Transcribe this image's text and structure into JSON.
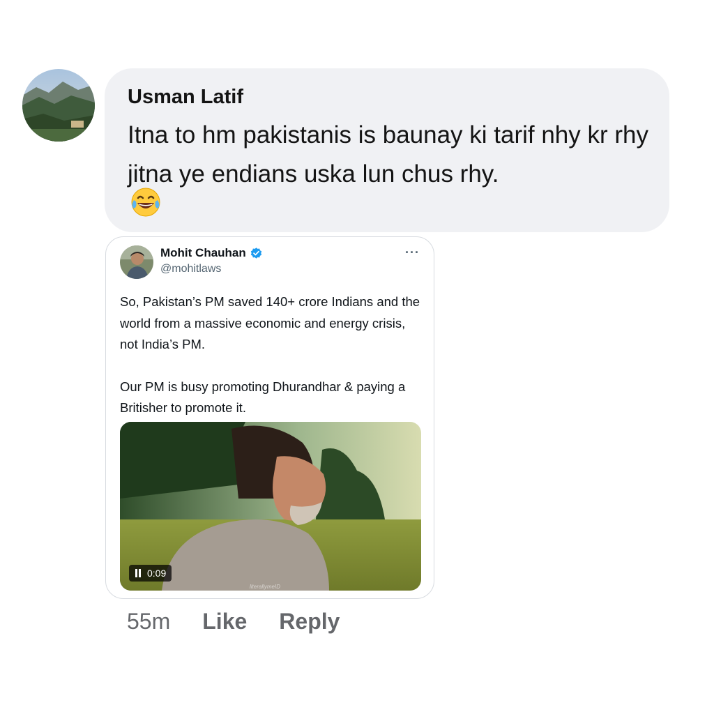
{
  "comment": {
    "author": "Usman Latif",
    "text": "Itna to hm pakistanis is baunay ki tarif nhy kr rhy jitna ye endians uska lun chus rhy.",
    "emoji": "face-with-tears-of-joy",
    "time": "55m",
    "like_label": "Like",
    "reply_label": "Reply"
  },
  "tweet": {
    "name": "Mohit Chauhan",
    "handle": "@mohitlaws",
    "verified": true,
    "more_label": "···",
    "paragraphs": [
      "So, Pakistan’s PM saved 140+ crore Indians and the world from a massive economic and energy crisis, not India’s PM.",
      "Our PM is busy promoting Dhurandhar & paying a Britisher to promote it."
    ],
    "video": {
      "duration": "0:09",
      "watermark": "literallymeID",
      "state": "playing"
    }
  },
  "colors": {
    "bubble_bg": "#f0f1f4",
    "verified_blue": "#1d9bf0",
    "meta_gray": "#65676b"
  }
}
